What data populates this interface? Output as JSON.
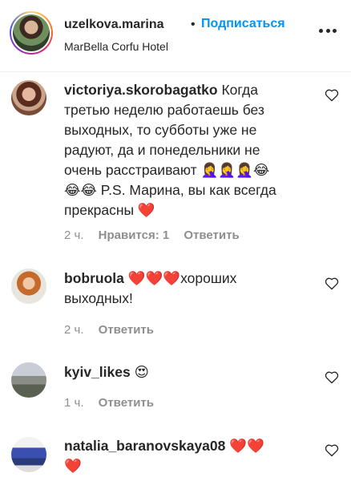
{
  "header": {
    "username": "uzelkova.marina",
    "dot": "•",
    "follow_label": "Подписаться",
    "location": "MarBella Corfu Hotel"
  },
  "comments": [
    {
      "username": "victoriya.skorobagatko",
      "lines": [
        "Когда",
        "третью неделю работаешь без",
        "выходных, то субботы уже не",
        "радуют, да и понедельники не",
        "очень расстраивают 🤦‍♀️🤦‍♀️🤦‍♀️😂",
        "😂😂 P.S. Марина, вы как всегда",
        "прекрасны ❤️"
      ],
      "time": "2 ч.",
      "likes": "Нравится: 1",
      "reply": "Ответить"
    },
    {
      "username": "bobruola",
      "lines": [
        "❤️❤️❤️хороших",
        "выходных!"
      ],
      "time": "2 ч.",
      "reply": "Ответить"
    },
    {
      "username": "kyiv_likes",
      "lines": [
        "😍"
      ],
      "time": "1 ч.",
      "reply": "Ответить"
    },
    {
      "username": "natalia_baranovskaya08",
      "lines": [
        "❤️❤️",
        "❤️"
      ]
    }
  ],
  "colors": {
    "link_blue": "#0095f6",
    "text": "#262626",
    "muted": "#8e8e8e"
  },
  "icons": [
    "more-icon",
    "heart-icon"
  ]
}
